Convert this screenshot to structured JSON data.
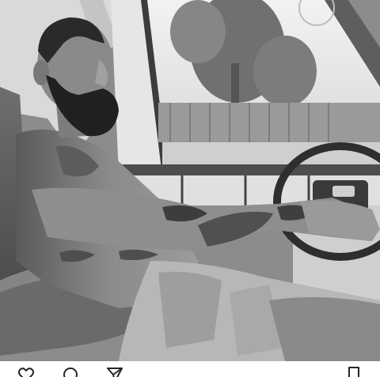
{
  "post": {
    "photo": {
      "subject": "photo-grayscale",
      "filter": "black-and-white"
    }
  },
  "actions": {
    "items": [
      {
        "icon": "heart-icon"
      },
      {
        "icon": "comment-icon"
      },
      {
        "icon": "share-icon"
      },
      {
        "icon": "bookmark-icon"
      }
    ]
  },
  "colors": {
    "background": "#ffffff",
    "icon": "#262626"
  }
}
